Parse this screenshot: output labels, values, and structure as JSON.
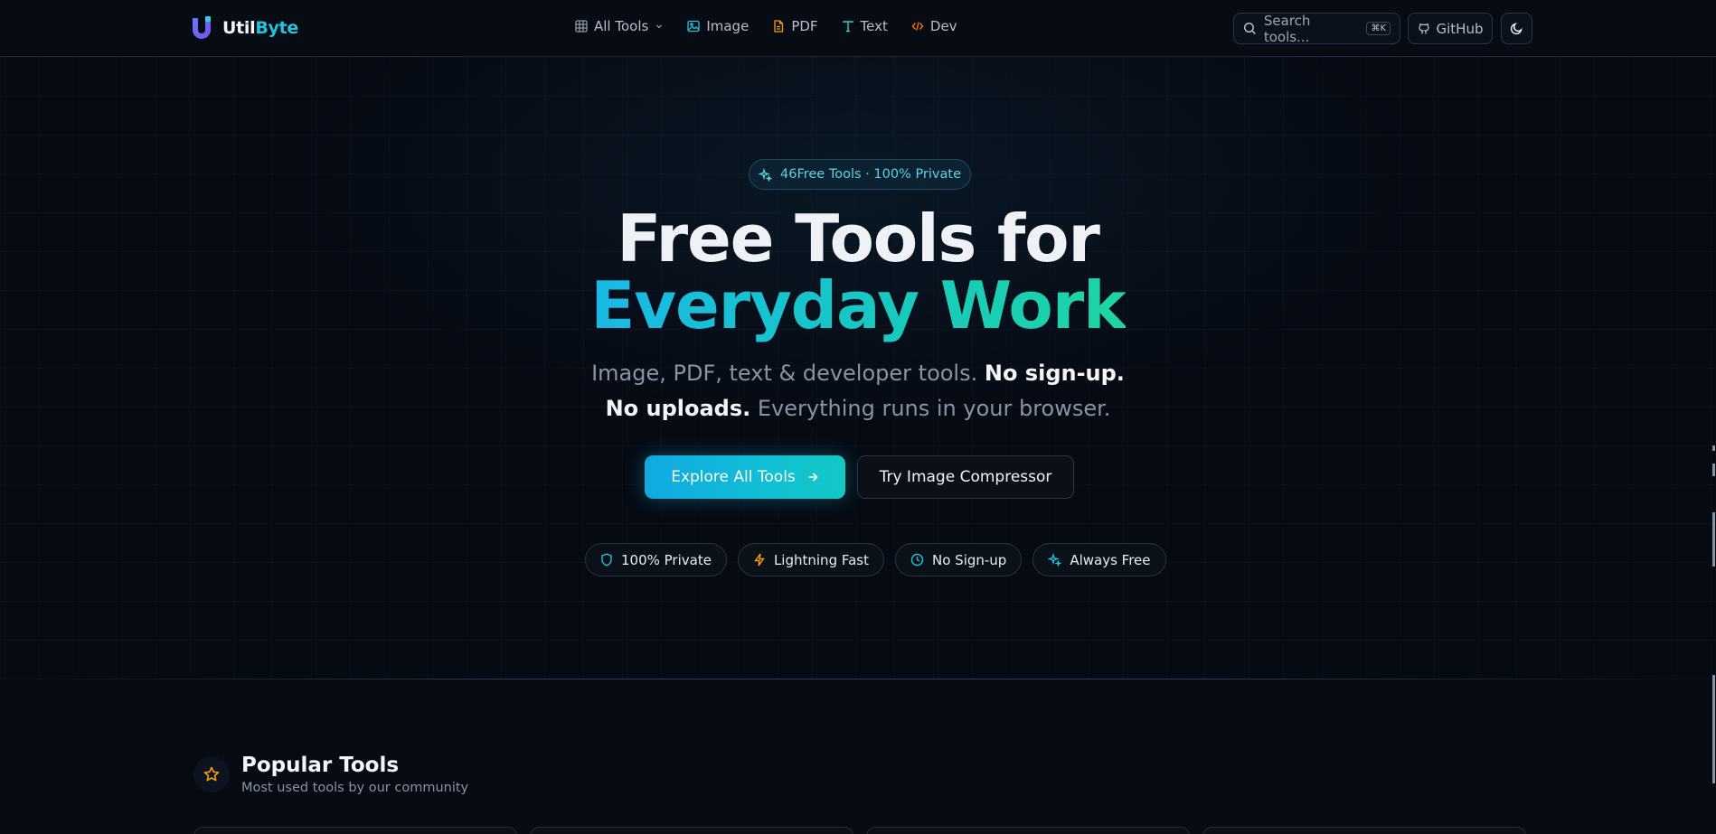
{
  "brand": {
    "name_part1": "Util",
    "name_part2": "Byte"
  },
  "nav": {
    "items": [
      {
        "label": "All Tools",
        "icon": "grid-icon"
      },
      {
        "label": "Image",
        "icon": "image-icon"
      },
      {
        "label": "PDF",
        "icon": "file-icon"
      },
      {
        "label": "Text",
        "icon": "type-icon"
      },
      {
        "label": "Dev",
        "icon": "code-icon"
      }
    ]
  },
  "search": {
    "placeholder": "Search tools...",
    "shortcut": "⌘K"
  },
  "github": {
    "label": "GitHub"
  },
  "hero": {
    "badge": "46Free Tools · 100% Private",
    "title_line1": "Free Tools for",
    "title_line2": "Everyday Work",
    "subtitle_part1": "Image, PDF, text & developer tools. ",
    "subtitle_bold": "No sign-up. No uploads.",
    "subtitle_part2": " Everything runs in your browser.",
    "primary_button": "Explore All Tools",
    "secondary_button": "Try Image Compressor"
  },
  "features": [
    {
      "label": "100% Private",
      "icon": "shield-icon",
      "color": "#22c3dc"
    },
    {
      "label": "Lightning Fast",
      "icon": "zap-icon",
      "color": "#f59e0b"
    },
    {
      "label": "No Sign-up",
      "icon": "clock-icon",
      "color": "#22c3dc"
    },
    {
      "label": "Always Free",
      "icon": "sparkles-icon",
      "color": "#22c3dc"
    }
  ],
  "popular": {
    "title": "Popular Tools",
    "subtitle": "Most used tools by our community"
  },
  "colors": {
    "accent": "#22c3dc",
    "background": "#060a13",
    "gradient_start": "#1ab8e6",
    "gradient_end": "#1fd4a2"
  }
}
